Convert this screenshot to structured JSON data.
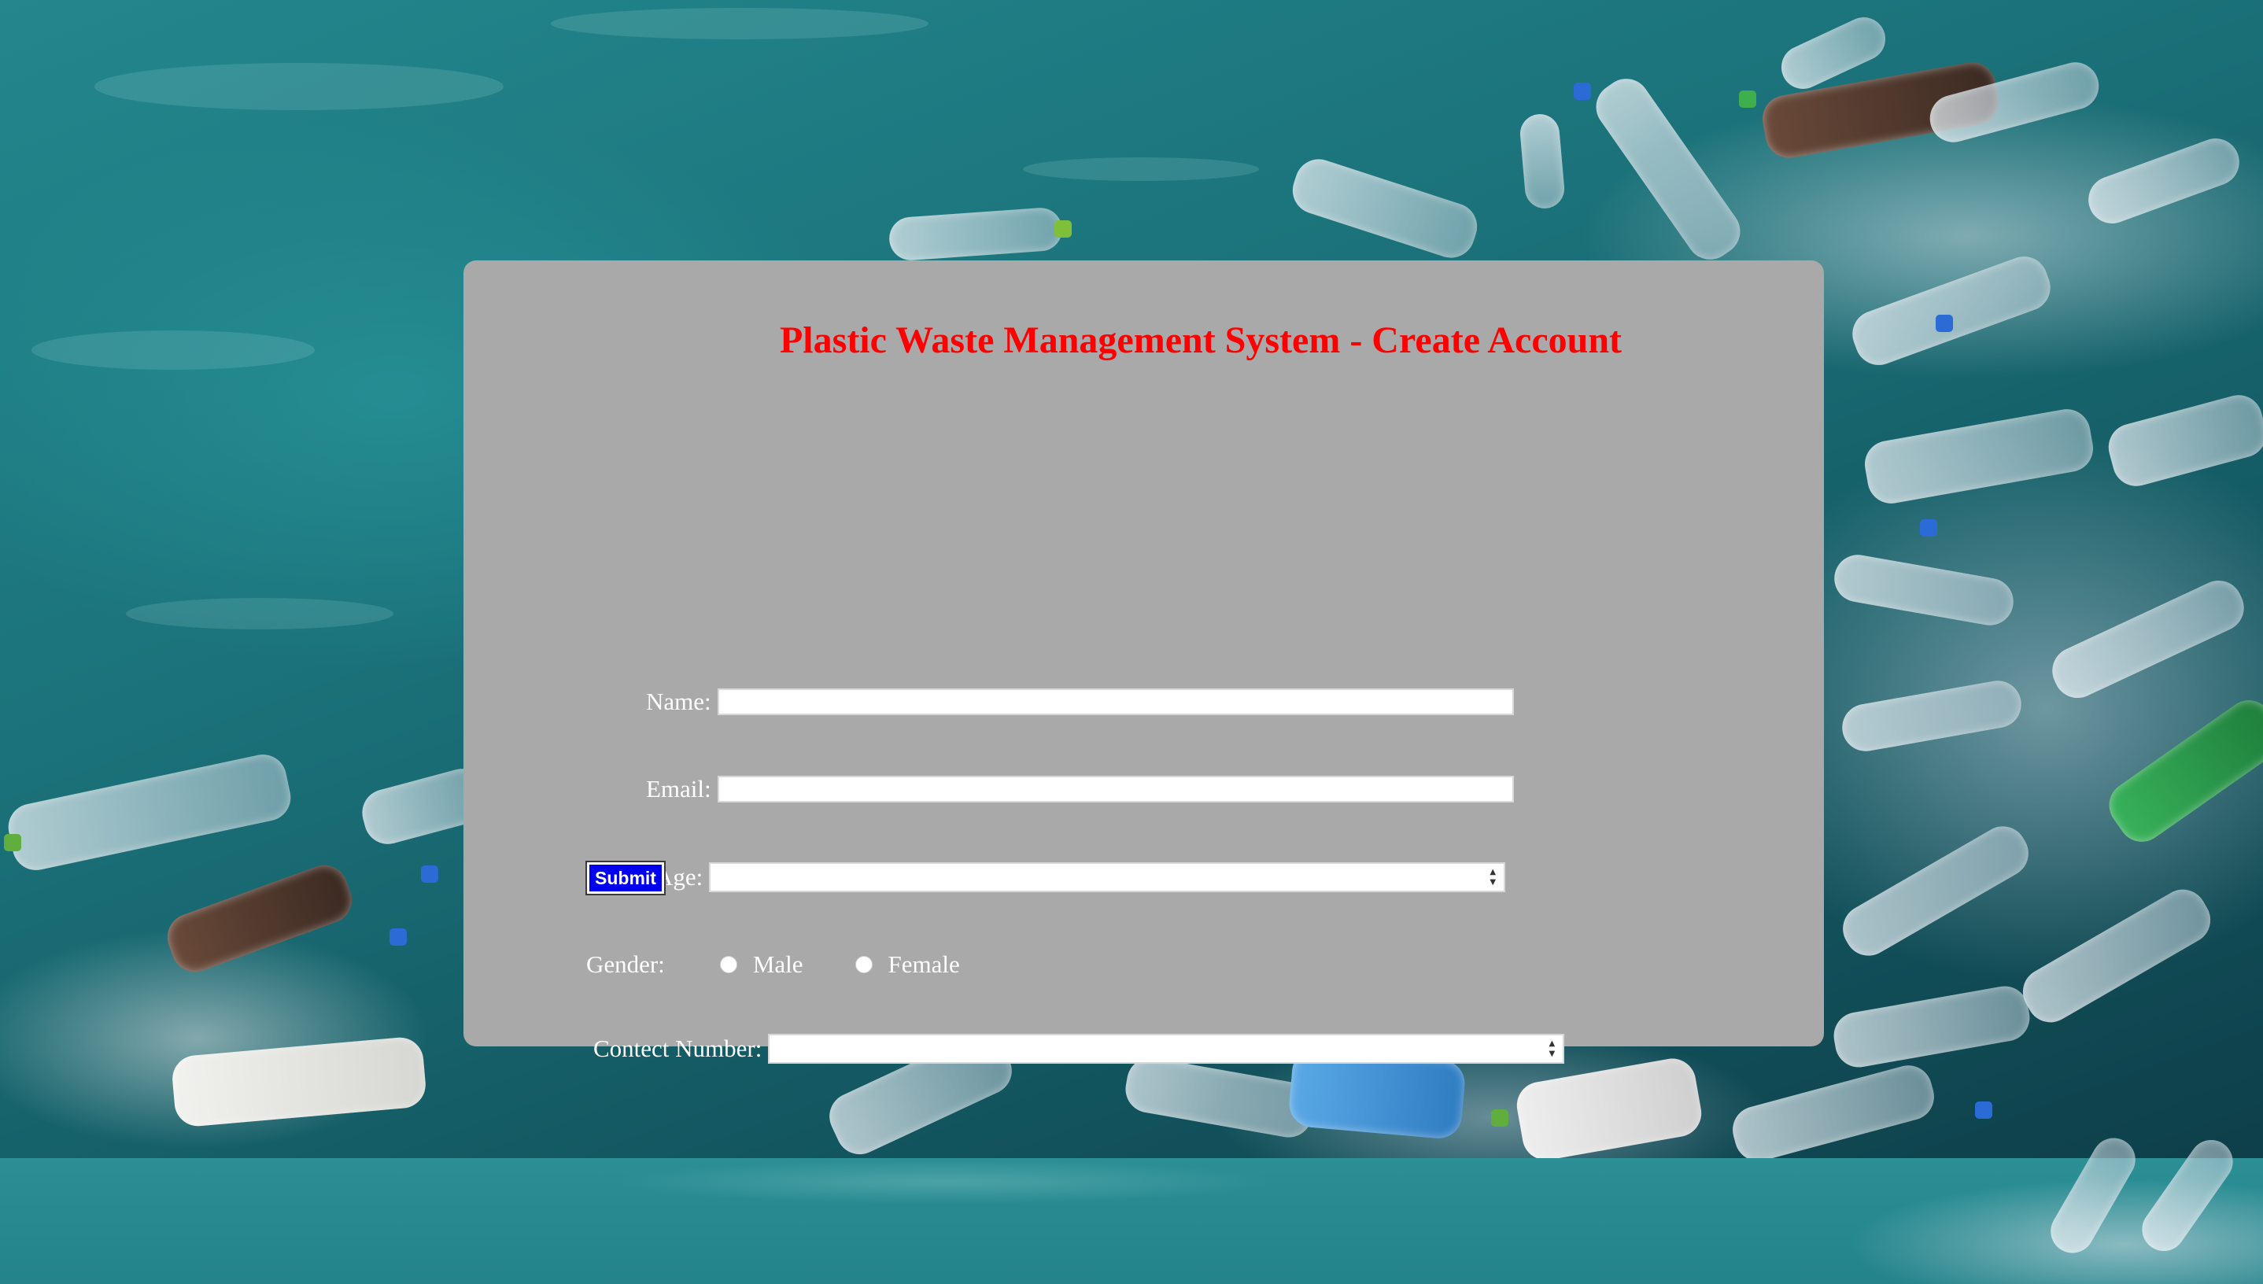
{
  "page": {
    "title": "Plastic Waste Management System - Create Account"
  },
  "form": {
    "name_label": "Name:",
    "name_value": "",
    "email_label": "Email:",
    "email_value": "",
    "age_label": "Age:",
    "age_value": "",
    "gender_label": "Gender:",
    "gender_options": [
      "Male",
      "Female"
    ],
    "contact_label": "Contect Number:",
    "contact_value": "",
    "submit_label": "Submit"
  },
  "colors": {
    "title": "#ff0000",
    "card_background": "#a9a9a9",
    "label_text": "#ffffff",
    "submit_background": "#0000ee"
  },
  "icons": {
    "spinner_up": "▲",
    "spinner_down": "▼"
  }
}
